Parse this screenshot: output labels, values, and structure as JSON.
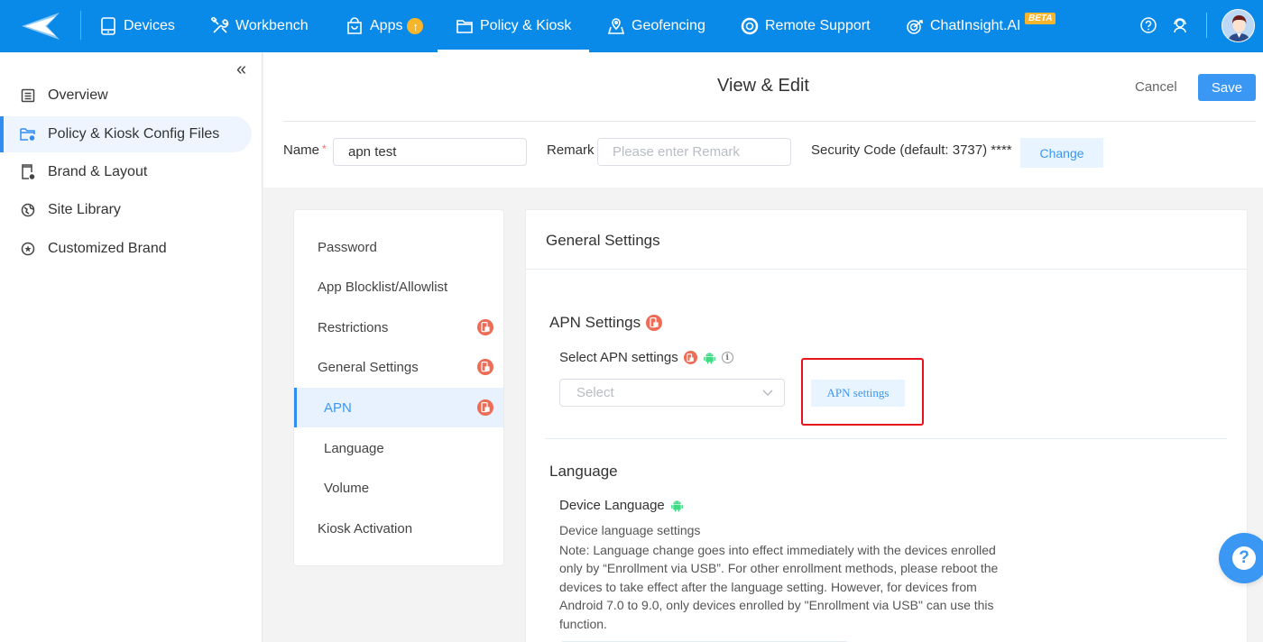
{
  "topbar": {
    "logo": "paper-plane-logo",
    "nav": [
      {
        "label": "Devices",
        "icon": "tablet-icon"
      },
      {
        "label": "Workbench",
        "icon": "tools-icon"
      },
      {
        "label": "Apps",
        "icon": "shopping-bag-icon",
        "badge": "↑"
      },
      {
        "label": "Policy & Kiosk",
        "icon": "folder-icon",
        "active": true
      },
      {
        "label": "Geofencing",
        "icon": "map-pin-icon"
      },
      {
        "label": "Remote Support",
        "icon": "lifebuoy-icon"
      },
      {
        "label": "ChatInsight.AI",
        "icon": "target-icon",
        "badge": "BETA"
      }
    ],
    "help_icon": "question-circle-icon",
    "support_icon": "headset-icon",
    "avatar": "user-avatar"
  },
  "sidebar": {
    "collapse_label": "«",
    "items": [
      {
        "label": "Overview",
        "icon": "document-icon"
      },
      {
        "label": "Policy & Kiosk Config Files",
        "icon": "folder-gear-icon",
        "active": true
      },
      {
        "label": "Brand & Layout",
        "icon": "phone-gear-icon"
      },
      {
        "label": "Site Library",
        "icon": "globe-icon"
      },
      {
        "label": "Customized Brand",
        "icon": "star-circle-icon"
      }
    ]
  },
  "header": {
    "title": "View & Edit",
    "cancel_label": "Cancel",
    "save_label": "Save",
    "name_label": "Name",
    "name_required": "*",
    "name_value": "apn test",
    "remark_label": "Remark",
    "remark_placeholder": "Please enter Remark",
    "security_label": "Security Code (default: 3737) ****",
    "change_label": "Change"
  },
  "menu": {
    "items": [
      {
        "label": "Password",
        "level": "top",
        "lock": false
      },
      {
        "label": "App Blocklist/Allowlist",
        "level": "top",
        "lock": false
      },
      {
        "label": "Restrictions",
        "level": "top",
        "lock": true
      },
      {
        "label": "General Settings",
        "level": "top",
        "lock": true
      },
      {
        "label": "APN",
        "level": "sub",
        "lock": true,
        "active": true
      },
      {
        "label": "Language",
        "level": "sub",
        "lock": false
      },
      {
        "label": "Volume",
        "level": "sub",
        "lock": false
      },
      {
        "label": "Kiosk Activation",
        "level": "top",
        "lock": false
      }
    ]
  },
  "content": {
    "title": "General Settings",
    "apn": {
      "section_title": "APN Settings",
      "select_label": "Select APN settings",
      "select_placeholder": "Select",
      "button_label": "APN settings"
    },
    "language": {
      "section_title": "Language",
      "device_language_label": "Device Language",
      "description": "Device language settings",
      "note": "Note: Language change goes into effect immediately with the devices enrolled only by “Enrollment via USB”. For other enrollment methods, please reboot the devices to take effect after the language setting. However, for devices from Android 7.0 to 9.0, only devices enrolled by \"Enrollment via USB\" can use this function."
    }
  },
  "help_fab": "?",
  "colors": {
    "brand": "#0a8ae8",
    "accent": "#3a97f4",
    "lock_badge": "#ee6b55",
    "android": "#3ddc84",
    "highlight": "#e8141b",
    "beta": "#f7b52c"
  }
}
